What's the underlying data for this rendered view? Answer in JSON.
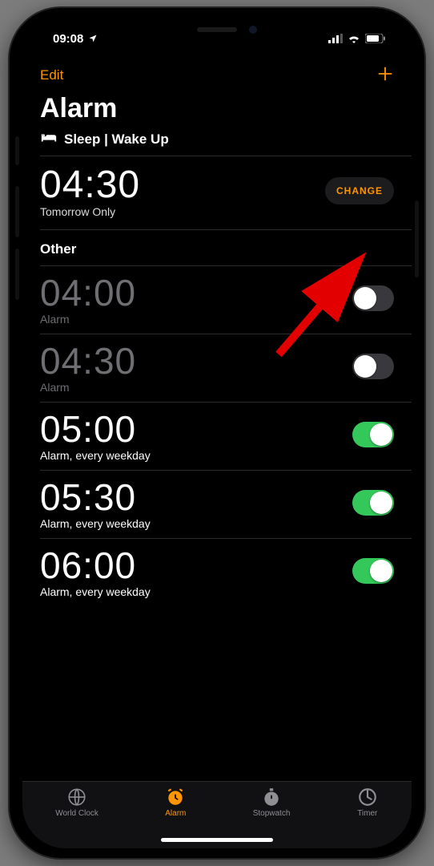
{
  "status": {
    "time": "09:08"
  },
  "nav": {
    "edit": "Edit"
  },
  "title": "Alarm",
  "sleep_section": {
    "header": "Sleep | Wake Up",
    "time": "04:30",
    "subtitle": "Tomorrow Only",
    "change_label": "CHANGE"
  },
  "other_section": {
    "header": "Other"
  },
  "alarms": [
    {
      "time": "04:00",
      "label": "Alarm",
      "enabled": false
    },
    {
      "time": "04:30",
      "label": "Alarm",
      "enabled": false
    },
    {
      "time": "05:00",
      "label": "Alarm, every weekday",
      "enabled": true
    },
    {
      "time": "05:30",
      "label": "Alarm, every weekday",
      "enabled": true
    },
    {
      "time": "06:00",
      "label": "Alarm, every weekday",
      "enabled": true
    }
  ],
  "tabs": {
    "world_clock": "World Clock",
    "alarm": "Alarm",
    "stopwatch": "Stopwatch",
    "timer": "Timer"
  }
}
